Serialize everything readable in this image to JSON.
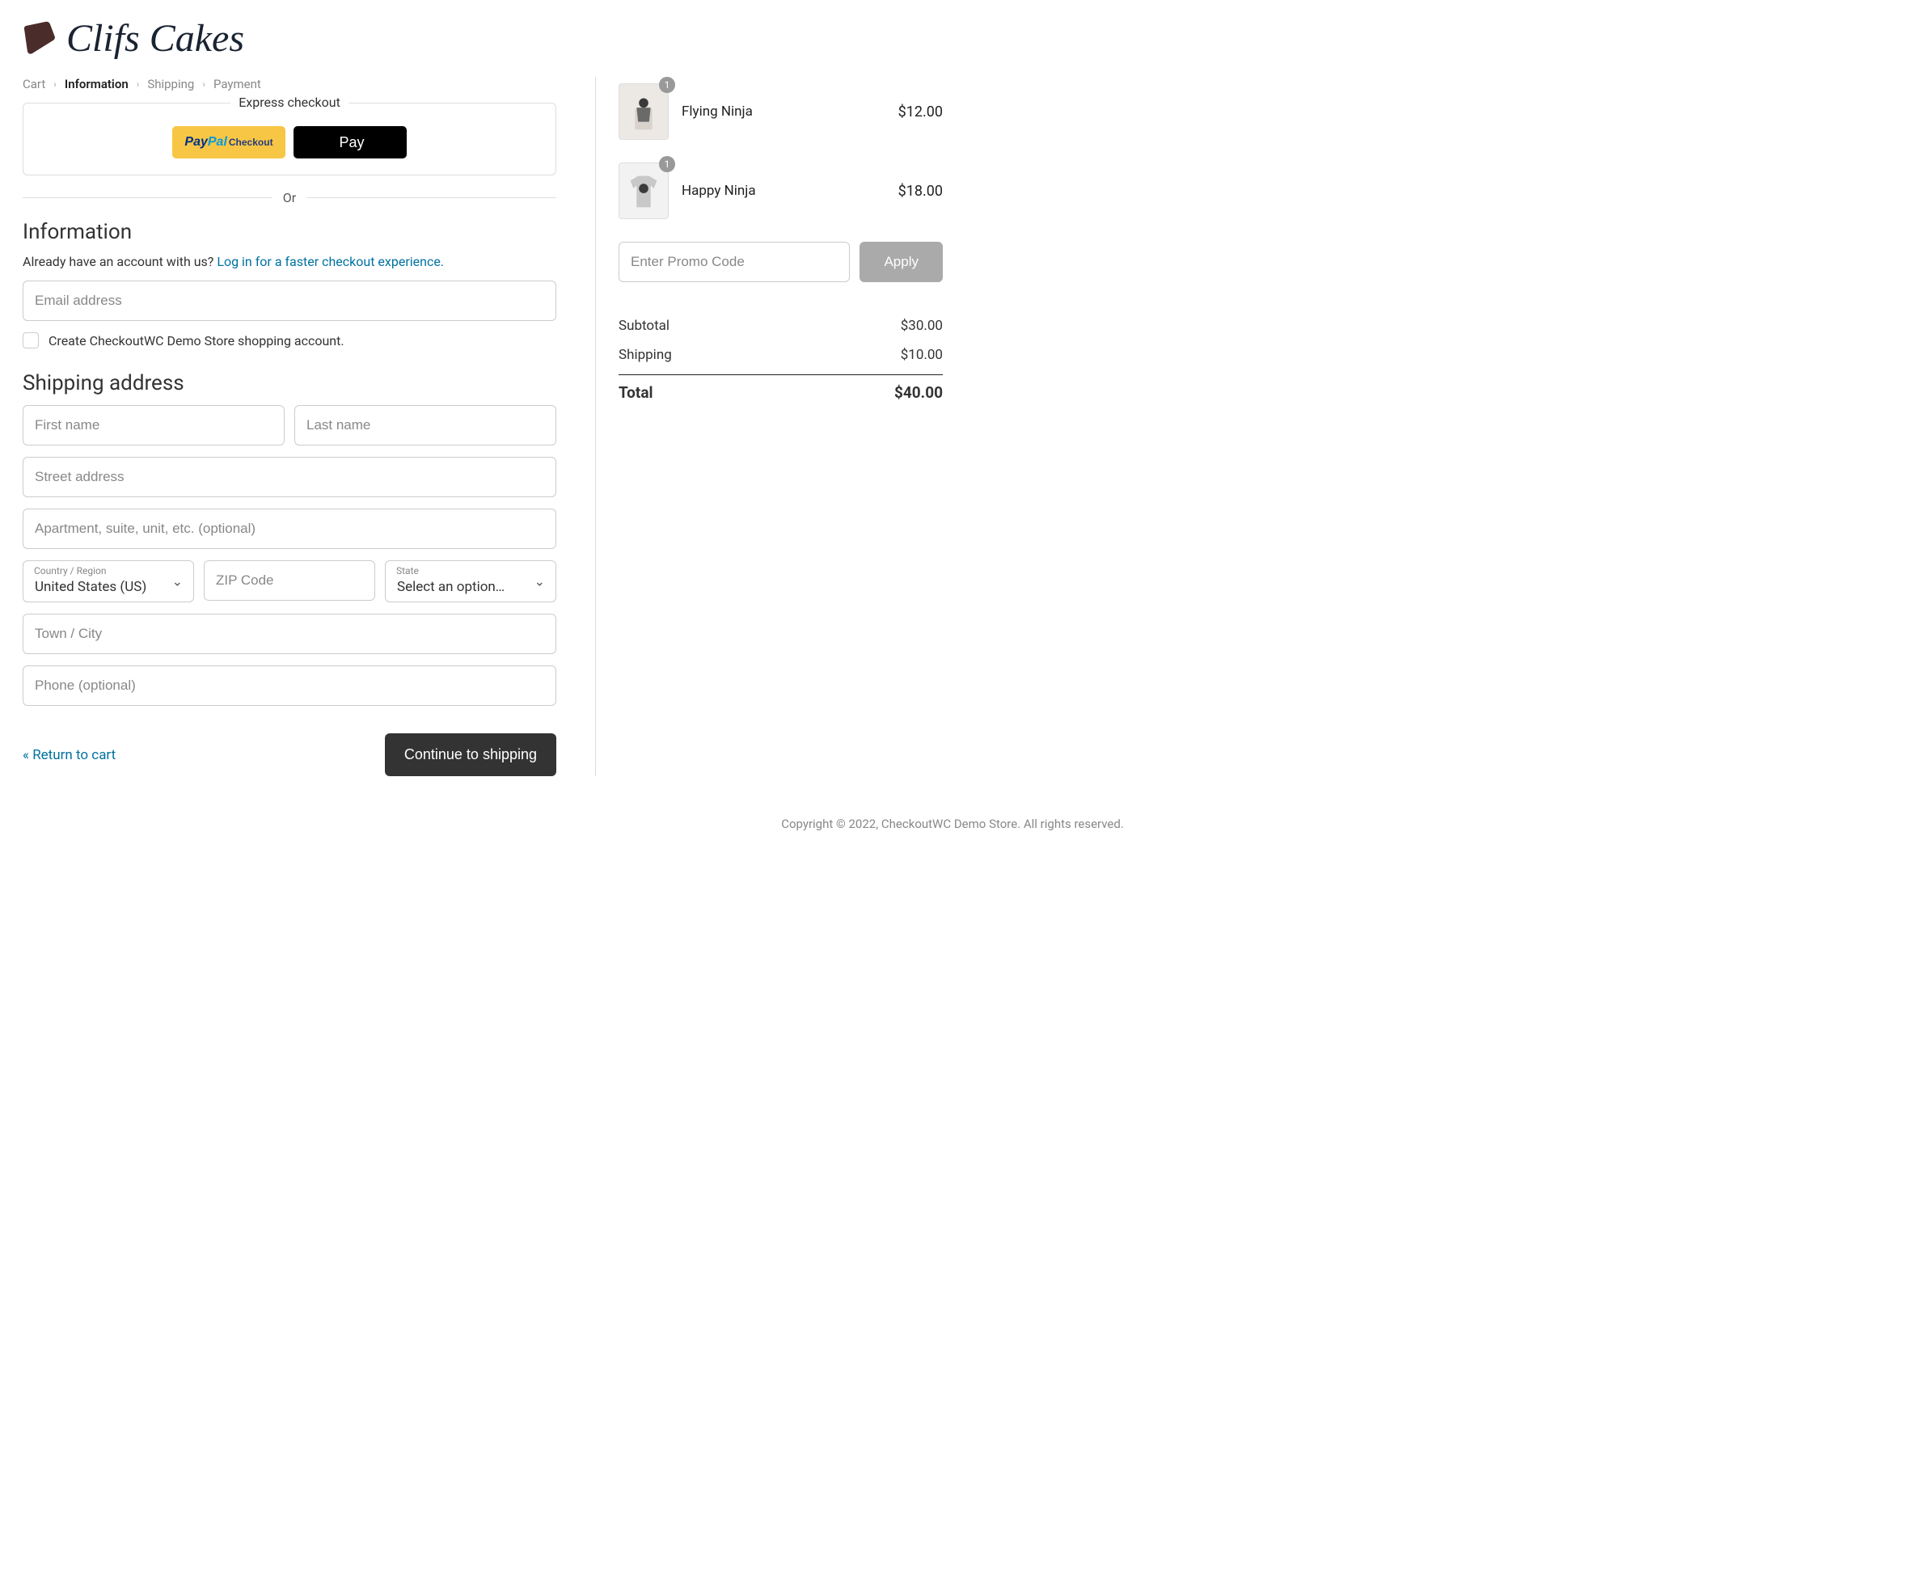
{
  "brand": {
    "name": "Clifs Cakes"
  },
  "breadcrumb": {
    "cart": "Cart",
    "information": "Information",
    "shipping": "Shipping",
    "payment": "Payment"
  },
  "express": {
    "title": "Express checkout",
    "paypal_checkout": "Checkout",
    "applepay": "Pay"
  },
  "divider_text": "Or",
  "information": {
    "heading": "Information",
    "prompt": "Already have an account with us? ",
    "login_link": "Log in for a faster checkout experience.",
    "email_placeholder": "Email address",
    "create_account_label": "Create CheckoutWC Demo Store shopping account."
  },
  "shipping": {
    "heading": "Shipping address",
    "first_name_placeholder": "First name",
    "last_name_placeholder": "Last name",
    "street_placeholder": "Street address",
    "apt_placeholder": "Apartment, suite, unit, etc. (optional)",
    "country_label": "Country / Region",
    "country_value": "United States (US)",
    "zip_placeholder": "ZIP Code",
    "state_label": "State",
    "state_value": "Select an option…",
    "city_placeholder": "Town / City",
    "phone_placeholder": "Phone (optional)"
  },
  "actions": {
    "return": "« Return to cart",
    "continue": "Continue to shipping"
  },
  "cart": {
    "items": [
      {
        "name": "Flying Ninja",
        "qty": "1",
        "price": "$12.00"
      },
      {
        "name": "Happy Ninja",
        "qty": "1",
        "price": "$18.00"
      }
    ],
    "promo_placeholder": "Enter Promo Code",
    "apply": "Apply",
    "subtotal_label": "Subtotal",
    "subtotal_value": "$30.00",
    "shipping_label": "Shipping",
    "shipping_value": "$10.00",
    "total_label": "Total",
    "total_value": "$40.00"
  },
  "footer": "Copyright © 2022, CheckoutWC Demo Store. All rights reserved."
}
